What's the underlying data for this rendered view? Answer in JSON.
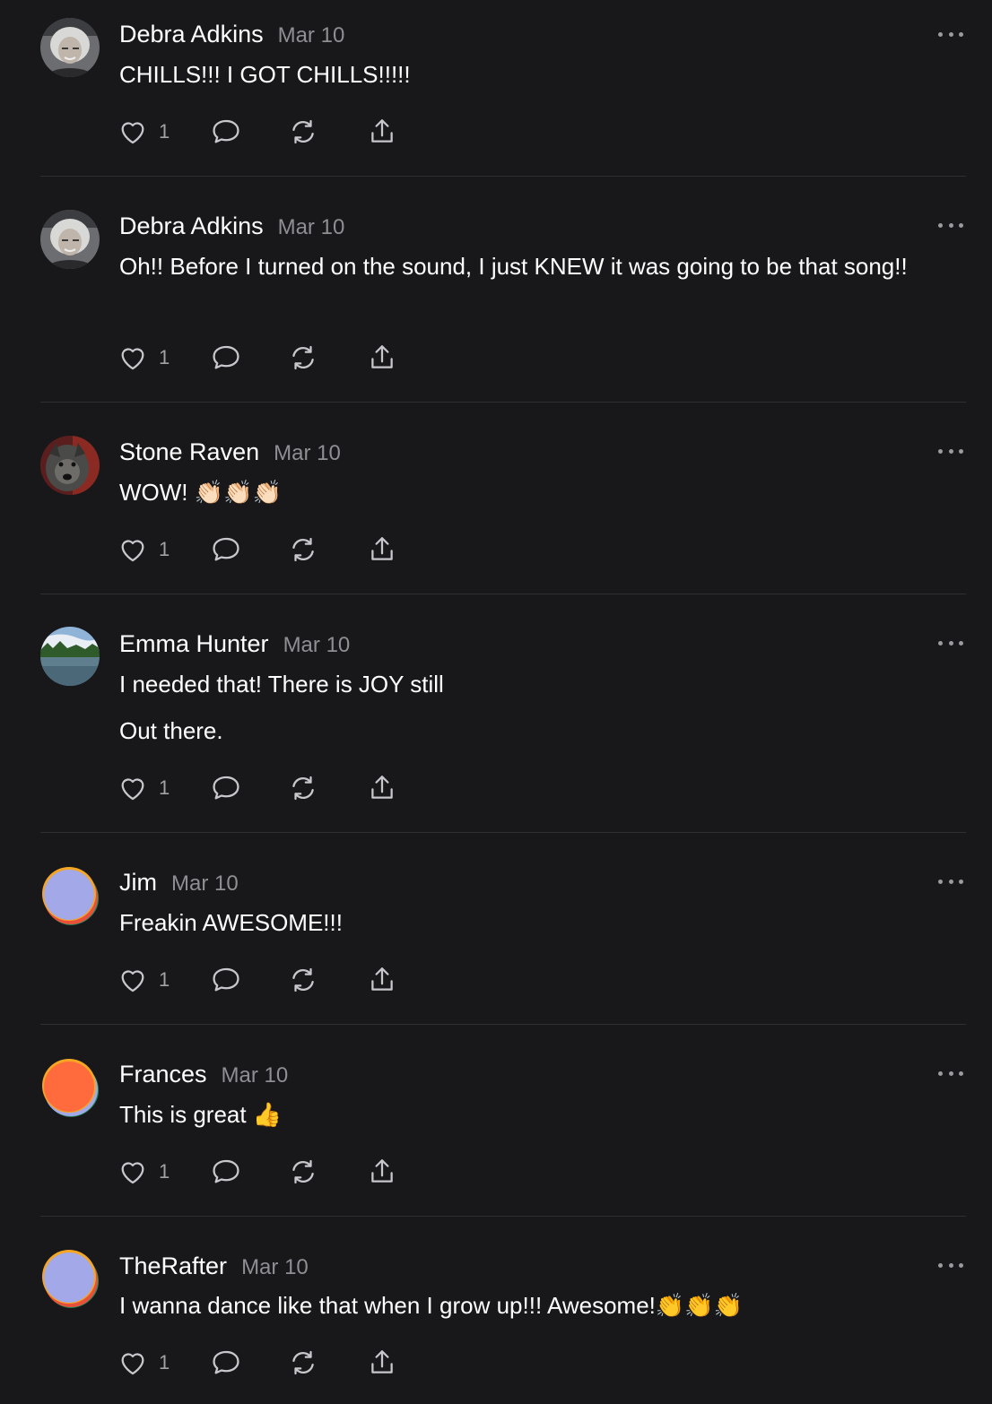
{
  "comments": [
    {
      "author": "Debra Adkins",
      "date": "Mar 10",
      "paragraphs": [
        "CHILLS!!! I GOT CHILLS!!!!!"
      ],
      "likes": "1",
      "avatar": "photo-woman"
    },
    {
      "author": "Debra Adkins",
      "date": "Mar 10",
      "paragraphs": [
        "Oh!! Before I turned on the sound, I just KNEW it was going to be that song!!"
      ],
      "likes": "1",
      "avatar": "photo-woman"
    },
    {
      "author": "Stone Raven",
      "date": "Mar 10",
      "paragraphs": [
        "WOW! 👏🏻👏🏻👏🏻"
      ],
      "likes": "1",
      "avatar": "photo-dog"
    },
    {
      "author": "Emma Hunter",
      "date": "Mar 10",
      "paragraphs": [
        "I needed that! There is JOY still",
        "Out there."
      ],
      "likes": "1",
      "avatar": "photo-lake"
    },
    {
      "author": "Jim",
      "date": "Mar 10",
      "paragraphs": [
        "Freakin AWESOME!!!"
      ],
      "likes": "1",
      "avatar": "generic-lavender",
      "avatar_colors": [
        "#a3a8e8",
        "#f5a623",
        "#1f8a5a",
        "#e8503a"
      ]
    },
    {
      "author": "Frances",
      "date": "Mar 10",
      "paragraphs": [
        "This is great 👍"
      ],
      "likes": "1",
      "avatar": "generic-orange",
      "avatar_colors": [
        "#ff6b3d",
        "#f5a623",
        "#1f8a5a",
        "#a3a8e8"
      ]
    },
    {
      "author": "TheRafter",
      "date": "Mar 10",
      "paragraphs": [
        "I wanna dance like that when I grow up!!! Awesome!👏👏👏"
      ],
      "likes": "1",
      "avatar": "generic-lavender",
      "avatar_colors": [
        "#a3a8e8",
        "#f5a623",
        "#1f8a5a",
        "#e8503a"
      ]
    }
  ],
  "icons": {
    "like": "heart-icon",
    "reply": "speech-bubble-icon",
    "restack": "restack-icon",
    "share": "share-icon",
    "more": "more-options-icon"
  },
  "colors": {
    "background": "#18181b",
    "text": "#ffffff",
    "muted": "#8e8e93",
    "divider": "#2e2e33"
  }
}
